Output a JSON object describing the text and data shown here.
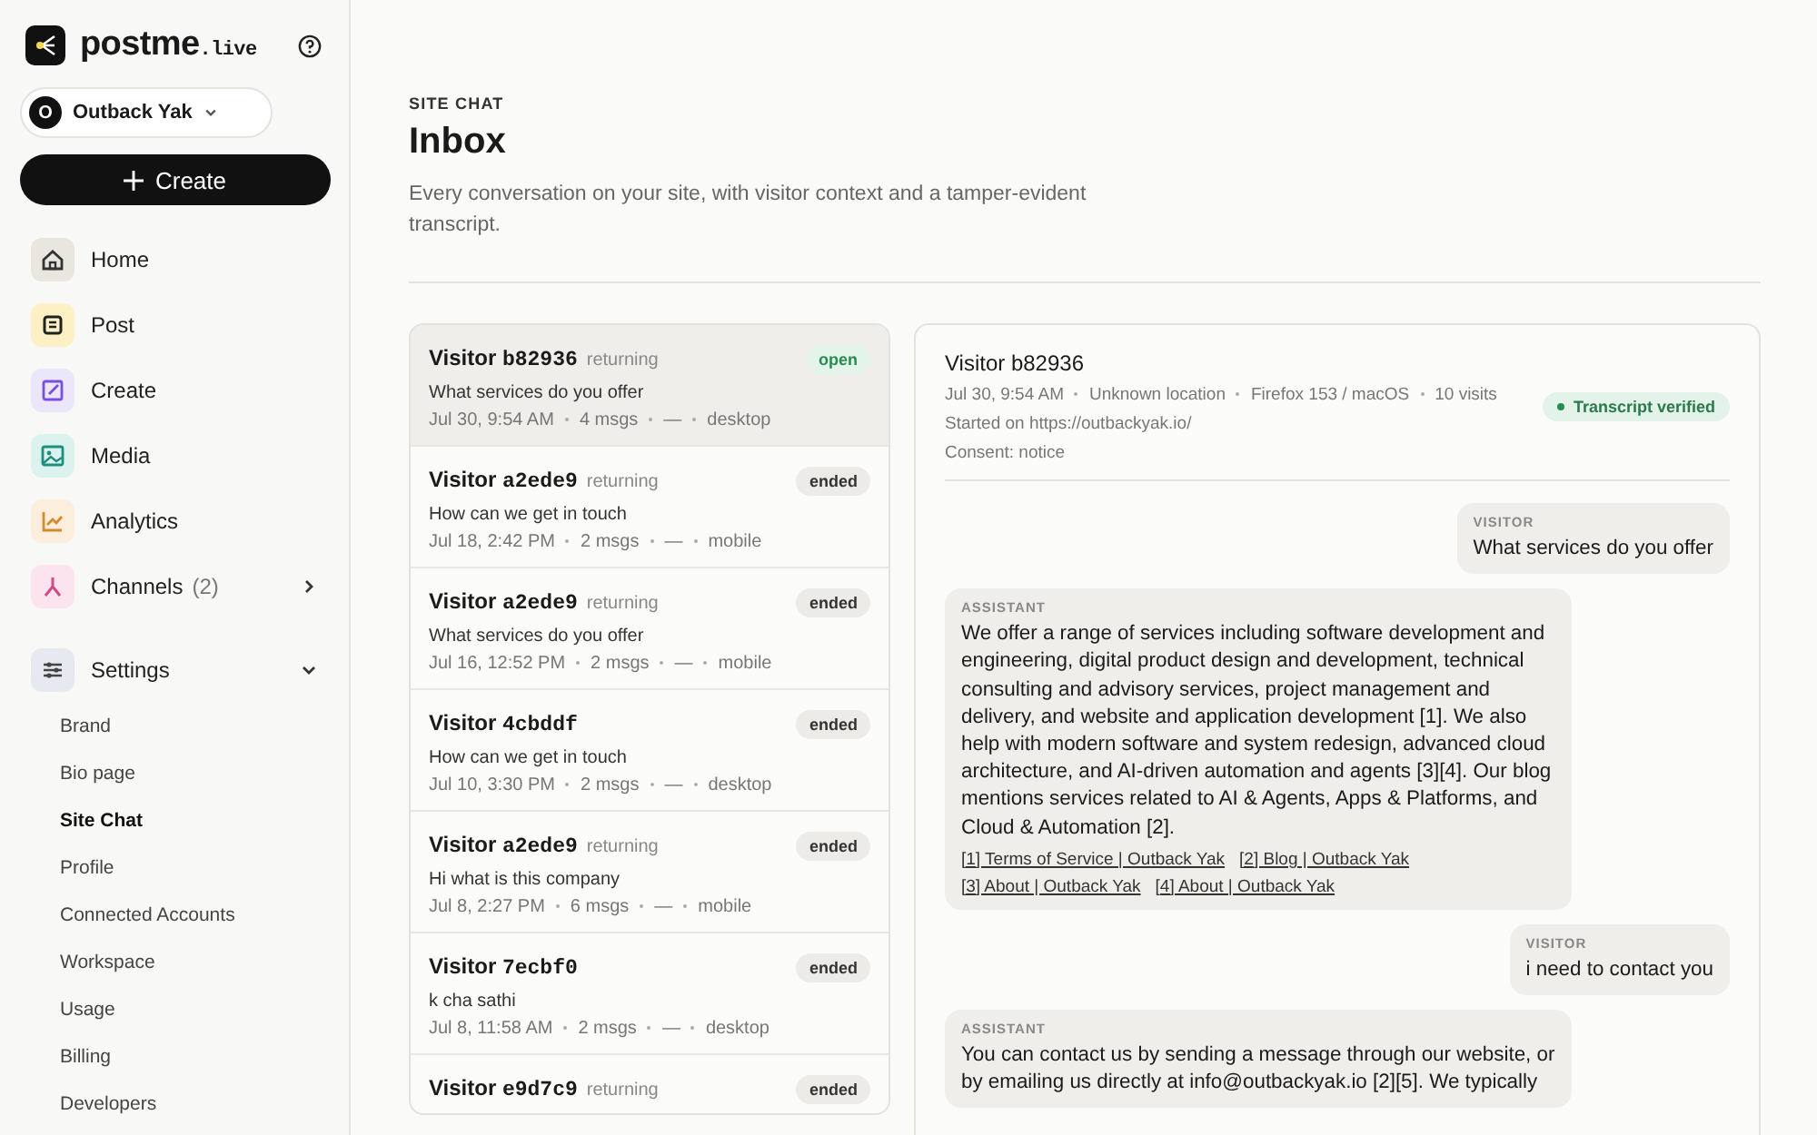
{
  "brand": {
    "name": "postme",
    "suffix": ".live"
  },
  "workspace": {
    "initial": "O",
    "name": "Outback Yak"
  },
  "create_button": "Create",
  "nav": [
    {
      "label": "Home",
      "kind": "home"
    },
    {
      "label": "Post",
      "kind": "post"
    },
    {
      "label": "Create",
      "kind": "create"
    },
    {
      "label": "Media",
      "kind": "media"
    },
    {
      "label": "Analytics",
      "kind": "analytics"
    },
    {
      "label": "Channels",
      "kind": "channels",
      "count": "(2)",
      "expanded": false
    },
    {
      "label": "Settings",
      "kind": "settings",
      "expanded": true,
      "children": [
        {
          "label": "Brand",
          "selected": false
        },
        {
          "label": "Bio page",
          "selected": false
        },
        {
          "label": "Site Chat",
          "selected": true
        },
        {
          "label": "Profile",
          "selected": false
        },
        {
          "label": "Connected Accounts",
          "selected": false
        },
        {
          "label": "Workspace",
          "selected": false
        },
        {
          "label": "Usage",
          "selected": false
        },
        {
          "label": "Billing",
          "selected": false
        },
        {
          "label": "Developers",
          "selected": false
        }
      ]
    }
  ],
  "header": {
    "section": "SITE CHAT",
    "title": "Inbox",
    "description": "Every conversation on your site, with visitor context and a tamper-evident transcript."
  },
  "conversations": [
    {
      "visitor": "Visitor",
      "id": "b82936",
      "tag": "returning",
      "preview": "What services do you offer",
      "meta": [
        "Jul 30, 9:54 AM",
        "4 msgs",
        "—",
        "desktop"
      ],
      "status": "open",
      "selected": true
    },
    {
      "visitor": "Visitor",
      "id": "a2ede9",
      "tag": "returning",
      "preview": "How can we get in touch",
      "meta": [
        "Jul 18, 2:42 PM",
        "2 msgs",
        "—",
        "mobile"
      ],
      "status": "ended",
      "selected": false
    },
    {
      "visitor": "Visitor",
      "id": "a2ede9",
      "tag": "returning",
      "preview": "What services do you offer",
      "meta": [
        "Jul 16, 12:52 PM",
        "2 msgs",
        "—",
        "mobile"
      ],
      "status": "ended",
      "selected": false
    },
    {
      "visitor": "Visitor",
      "id": "4cbddf",
      "preview": "How can we get in touch",
      "meta": [
        "Jul 10, 3:30 PM",
        "2 msgs",
        "—",
        "desktop"
      ],
      "status": "ended",
      "selected": false
    },
    {
      "visitor": "Visitor",
      "id": "a2ede9",
      "tag": "returning",
      "preview": "Hi what is this company",
      "meta": [
        "Jul 8, 2:27 PM",
        "6 msgs",
        "—",
        "mobile"
      ],
      "status": "ended",
      "selected": false
    },
    {
      "visitor": "Visitor",
      "id": "7ecbf0",
      "preview": "k cha sathi",
      "meta": [
        "Jul 8, 11:58 AM",
        "2 msgs",
        "—",
        "desktop"
      ],
      "status": "ended",
      "selected": false
    },
    {
      "visitor": "Visitor",
      "id": "e9d7c9",
      "tag": "returning",
      "status": "ended",
      "selected": false
    }
  ],
  "detail": {
    "title": "Visitor b82936",
    "meta": [
      "Jul 30, 9:54 AM",
      "Unknown location",
      "Firefox 153 / macOS",
      "10 visits"
    ],
    "started": "Started on https://outbackyak.io/",
    "consent": "Consent: notice",
    "verified": true,
    "verified_label": "Transcript verified",
    "messages": [
      {
        "kind": "visitor",
        "label": "VISITOR",
        "text": "What services do you offer"
      },
      {
        "kind": "assistant",
        "label": "ASSISTANT",
        "text": "We offer a range of services including software development and engineering, digital product design and development, technical consulting and advisory services, project management and delivery, and website and application development [1]. We also help with modern software and system redesign, advanced cloud architecture, and AI-driven automation and agents [3][4]. Our blog mentions services related to AI & Agents, Apps & Platforms, and Cloud & Automation [2].",
        "sources": [
          "[1] Terms of Service | Outback Yak",
          "[2] Blog | Outback Yak",
          "[3] About | Outback Yak",
          "[4] About | Outback Yak"
        ]
      },
      {
        "kind": "visitor",
        "label": "VISITOR",
        "text": "i need to contact you"
      },
      {
        "kind": "assistant",
        "label": "ASSISTANT",
        "text": "You can contact us by sending a message through our website, or by emailing us directly at info@outbackyak.io [2][5]. We typically"
      }
    ]
  }
}
